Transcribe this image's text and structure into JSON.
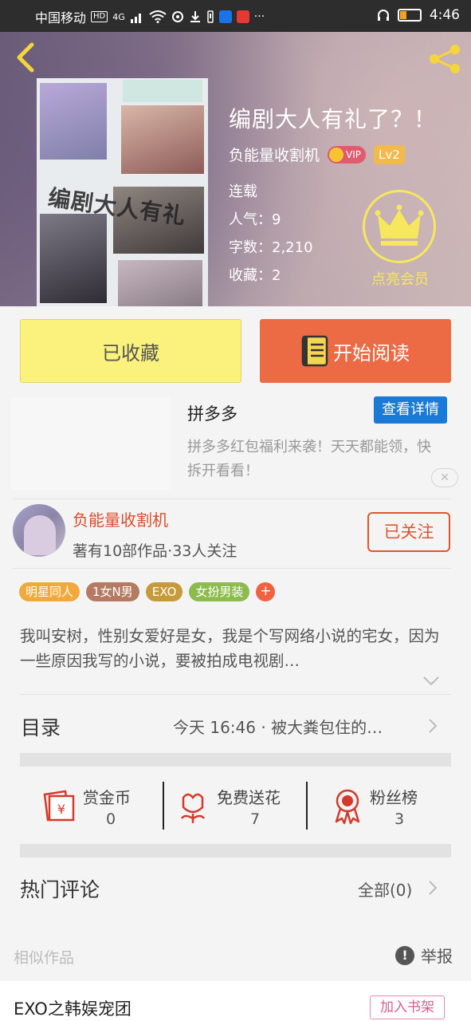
{
  "status_bar": {
    "carrier": "中国移动",
    "hd": "HD",
    "network": "4G",
    "time": "4:46"
  },
  "hero": {
    "book_title": "编剧大人有礼了？！",
    "author": "负能量收割机",
    "vip_label": "VIP",
    "level": "Lv2",
    "status": "连载",
    "popularity_label": "人气：",
    "popularity": "9",
    "words_label": "字数：",
    "words": "2,210",
    "favorites_label": "收藏：",
    "favorites": "2",
    "member_label": "点亮会员",
    "cover_text": "编剧大人有礼"
  },
  "actions": {
    "favorited": "已收藏",
    "start_reading": "开始阅读"
  },
  "ad": {
    "title": "拼多多",
    "detail_button": "查看详情",
    "description": "拼多多红包福利来袭！天天都能领，快拆开看看！"
  },
  "author_block": {
    "name": "负能量收割机",
    "stats": "著有10部作品·33人关注",
    "follow_button": "已关注"
  },
  "tags": [
    {
      "label": "明星同人",
      "color": "#f2a93b"
    },
    {
      "label": "1女N男",
      "color": "#b57b62"
    },
    {
      "label": "EXO",
      "color": "#c79a3a"
    },
    {
      "label": "女扮男装",
      "color": "#8dbb4d"
    }
  ],
  "synopsis": "我叫安树，性别女爱好是女，我是个写网络小说的宅女，因为一些原因我写的小说，要被拍成电视剧…",
  "catalog": {
    "title": "目录",
    "latest": "今天 16:46 · 被大粪包住的…"
  },
  "stats": [
    {
      "label": "赏金币",
      "value": "0",
      "icon": "red-envelope-icon"
    },
    {
      "label": "免费送花",
      "value": "7",
      "icon": "flower-icon"
    },
    {
      "label": "粉丝榜",
      "value": "3",
      "icon": "medal-icon"
    }
  ],
  "comments": {
    "title": "热门评论",
    "all": "全部(0)"
  },
  "similar": {
    "label": "相似作品",
    "report": "举报",
    "first_title": "EXO之韩娱宠团",
    "add_shelf": "加入书架"
  },
  "colors": {
    "accent_orange": "#ec6a44",
    "favorite_yellow": "#fbf17d",
    "member_gold": "#f7e75e",
    "ad_blue": "#1b7ad6"
  }
}
